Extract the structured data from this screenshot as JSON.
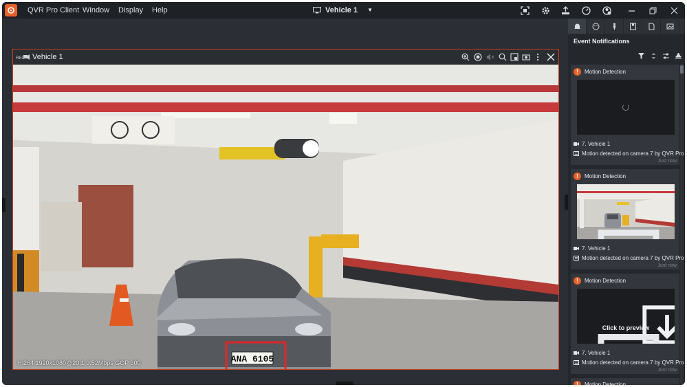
{
  "app": {
    "name": "QVR Pro Client",
    "menus": [
      "Window",
      "Display",
      "Help"
    ],
    "center_title": "Vehicle 1"
  },
  "video": {
    "title": "Vehicle 1",
    "stream_info": "H.264 1920x1080@20.1 9.52Mbps GOP 300",
    "plate_text": "ANA 6105",
    "highlight_color": "#e0262a"
  },
  "sidebar": {
    "heading": "Event Notifications",
    "events": [
      {
        "type": "Motion Detection",
        "camera": "7. Vehicle 1",
        "message": "Motion detected on camera 7 by QVR Pro",
        "time": "Just now",
        "thumb": "loading"
      },
      {
        "type": "Motion Detection",
        "camera": "7. Vehicle 1",
        "message": "Motion detected on camera 7 by QVR Pro",
        "time": "Just now",
        "thumb": "image"
      },
      {
        "type": "Motion Detection",
        "camera": "7. Vehicle 1",
        "message": "Motion detected on camera 7 by QVR Pro",
        "time": "Just now",
        "thumb": "preview",
        "preview_label": "Click to preview"
      },
      {
        "type": "Motion Detection"
      }
    ]
  },
  "colors": {
    "accent": "#e8622a",
    "titlebar": "#1e2126",
    "panel": "#2b2f35"
  }
}
